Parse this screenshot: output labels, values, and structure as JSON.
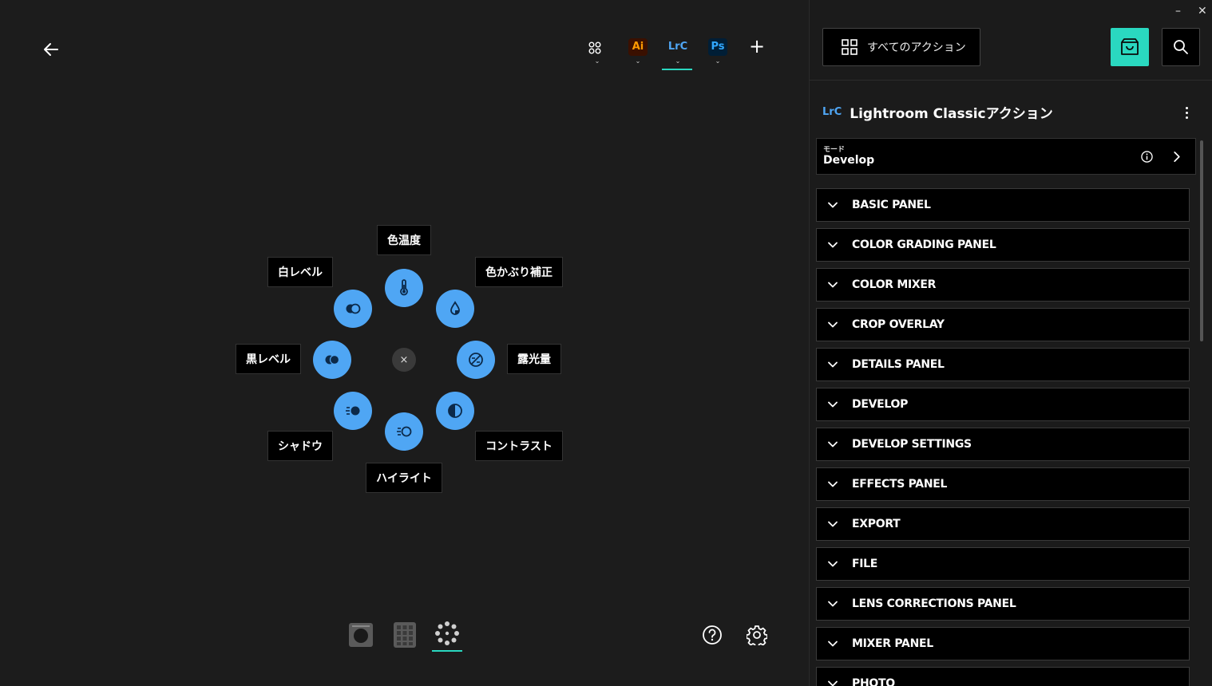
{
  "window": {
    "minimize": "–",
    "close": "✕"
  },
  "apps": {
    "all_icon": "apps-grid-icon",
    "tabs": [
      {
        "label": "Ai",
        "color": "#ff9a00",
        "bg": "#3a1000"
      },
      {
        "label": "LrC",
        "color": "#4fa6f4",
        "bg": "transparent",
        "selected": true
      },
      {
        "label": "Ps",
        "color": "#31a8ff",
        "bg": "#001e36"
      }
    ],
    "chevron": "⌄",
    "add_label": "+"
  },
  "wheel": {
    "center": "×",
    "labels": {
      "temp": "色温度",
      "tint": "色かぶり補正",
      "exposure": "露光量",
      "contrast": "コントラスト",
      "highlights": "ハイライト",
      "shadows": "シャドウ",
      "blacks": "黒レベル",
      "whites": "白レベル"
    }
  },
  "accent": "#2ad8c0",
  "button_blue": "#4fa6f4",
  "panel": {
    "all_actions": "すべてのアクション",
    "app_tag": "LrC",
    "title": "Lightroom Classicアクション",
    "mode_label": "モード",
    "mode_value": "Develop",
    "sections": [
      "BASIC PANEL",
      "COLOR GRADING PANEL",
      "COLOR MIXER",
      "CROP OVERLAY",
      "DETAILS PANEL",
      "DEVELOP",
      "DEVELOP SETTINGS",
      "EFFECTS PANEL",
      "EXPORT",
      "FILE",
      "LENS CORRECTIONS PANEL",
      "MIXER PANEL",
      "PHOTO"
    ]
  }
}
